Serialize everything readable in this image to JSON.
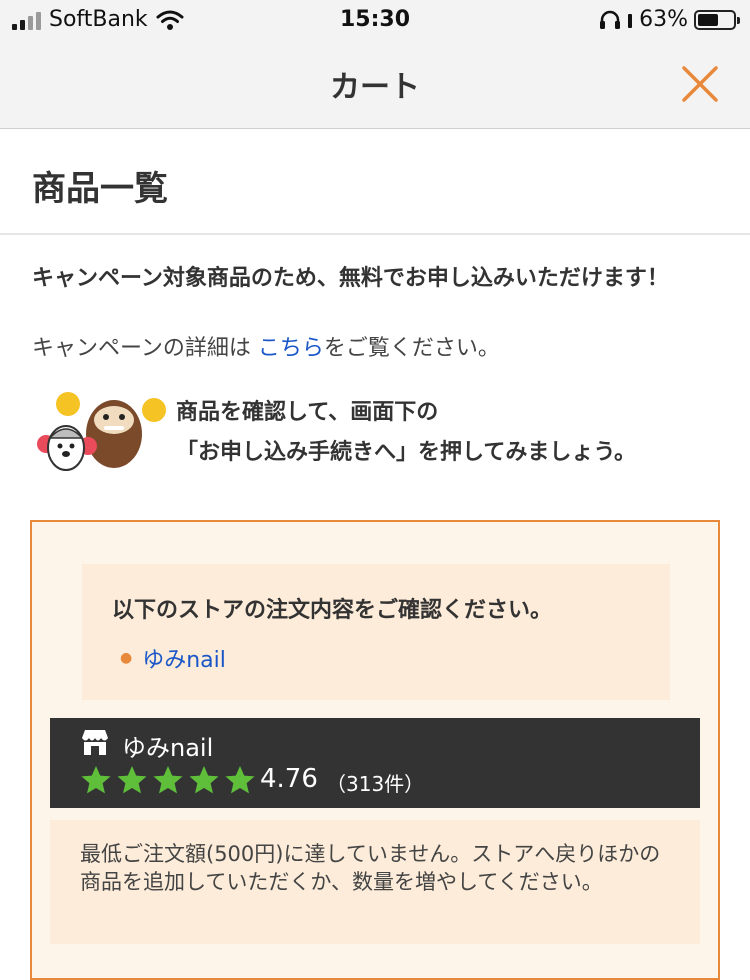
{
  "status_bar": {
    "carrier": "SoftBank",
    "time": "15:30",
    "battery_percent": "63%",
    "signal_icon": "signal-bars-icon",
    "wifi_icon": "wifi-icon",
    "headphones_icon": "headphones-icon",
    "battery_icon": "battery-icon",
    "battery_level": 0.63
  },
  "nav": {
    "title": "カート",
    "close_icon": "close-icon",
    "accent_color": "#e8883b"
  },
  "section": {
    "title": "商品一覧"
  },
  "campaign": {
    "headline": "キャンペーン対象商品のため、無料でお申し込みいただけます！",
    "detail_prefix": "キャンペーンの詳細は",
    "detail_link": "こちら",
    "detail_suffix": "をご覧ください。"
  },
  "instruction": {
    "line1": "商品を確認して、画面下の",
    "line2": "「お申し込み手続きへ」を押してみましょう。",
    "mascot_icon": "mascot-cheer-icon"
  },
  "order": {
    "confirm_text": "以下のストアの注文内容をご確認ください。",
    "store_link": "ゆみnail",
    "store": {
      "name": "ゆみnail",
      "store_icon": "store-icon",
      "star_icon": "star-icon",
      "stars": 5,
      "rating": "4.76",
      "review_count": "（313件）"
    },
    "warning": "最低ご注文額(500円)に達していません。ストアへ戻りほかの商品を追加していただくか、数量を増やしてください。"
  },
  "colors": {
    "accent": "#e8883b",
    "link": "#1a56c8",
    "star": "#5fbf3a",
    "store_bar": "#333333",
    "panel_bg": "#fcecd9"
  }
}
